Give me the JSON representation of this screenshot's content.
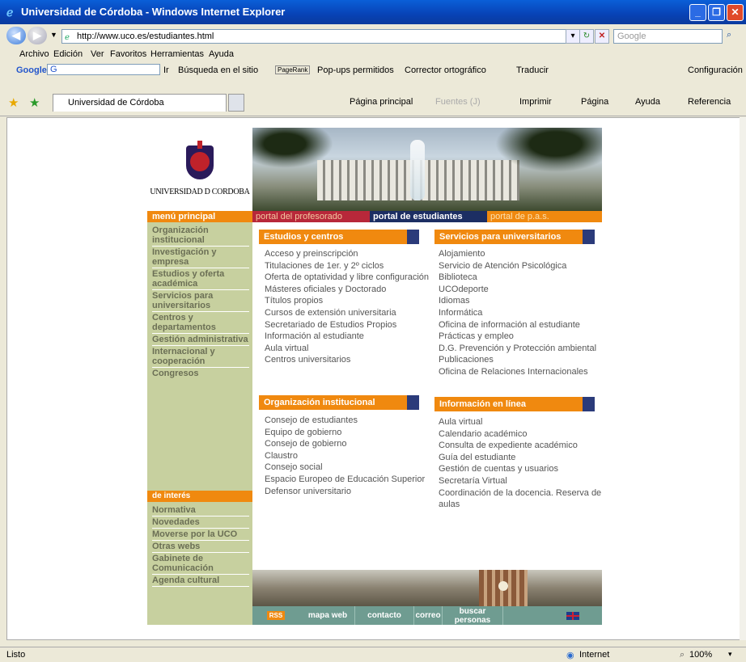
{
  "window": {
    "title": "Universidad de Córdoba - Windows Internet Explorer"
  },
  "address": {
    "url": "http://www.uco.es/estudiantes.html",
    "search_placeholder": "Google"
  },
  "menubar": [
    "Archivo",
    "Edición",
    "Ver",
    "Favoritos",
    "Herramientas",
    "Ayuda"
  ],
  "googlebar": {
    "logo": "Google",
    "g_field": "G",
    "ir": "Ir",
    "busqueda": "Búsqueda en el sitio",
    "pagerank": "PageRank",
    "popups": "Pop-ups permitidos",
    "corrector": "Corrector ortográfico",
    "traducir": "Traducir",
    "config": "Configuración"
  },
  "tabbar": {
    "tab_title": "Universidad de Córdoba",
    "pagina_principal": "Página principal",
    "fuentes": "Fuentes (J)",
    "imprimir": "Imprimir",
    "pagina": "Página",
    "ayuda": "Ayuda",
    "referencia": "Referencia"
  },
  "status": {
    "text": "Listo",
    "zone": "Internet",
    "zoom": "100%"
  },
  "site": {
    "logo_text": "UNIVERSIDAD D CORDOBA",
    "menu_head": "menú principal",
    "menu": [
      "Organización institucional",
      "Investigación y empresa",
      "Estudios y oferta académica",
      "Servicios para universitarios",
      "Centros y departamentos",
      "Gestión administrativa",
      "Internacional y cooperación",
      "Congresos"
    ],
    "interest_head": "de interés",
    "interest": [
      "Normativa",
      "Novedades",
      "Moverse por la UCO",
      "Otras webs",
      "Gabinete de Comunicación",
      "Agenda cultural"
    ],
    "portals": {
      "profesorado": "portal del profesorado",
      "estudiantes": "portal de estudiantes",
      "pas": "portal de p.a.s."
    },
    "estudios": {
      "title": "Estudios y centros",
      "links": [
        "Acceso y preinscripción",
        "Titulaciones de 1er. y 2º ciclos",
        "Oferta de optatividad y libre configuración",
        "Másteres oficiales y Doctorado",
        "Títulos propios",
        "Cursos de extensión universitaria",
        "Secretariado de Estudios Propios",
        "Información al estudiante",
        "Aula virtual",
        "Centros universitarios"
      ]
    },
    "servicios": {
      "title": "Servicios para universitarios",
      "links": [
        "Alojamiento",
        "Servicio de Atención Psicológica",
        "Biblioteca",
        "UCOdeporte",
        "Idiomas",
        "Informática",
        "Oficina de información al estudiante",
        "Prácticas y empleo",
        "D.G. Prevención y Protección ambiental",
        "Publicaciones",
        "Oficina de Relaciones Internacionales"
      ]
    },
    "organizacion": {
      "title": "Organización institucional",
      "links": [
        "Consejo de estudiantes",
        "Equipo de gobierno",
        "Consejo de gobierno",
        "Claustro",
        "Consejo social",
        "Espacio Europeo de Educación Superior",
        "Defensor universitario"
      ]
    },
    "informacion": {
      "title": "Información en línea",
      "links": [
        "Aula virtual",
        "Calendario académico",
        "Consulta de expediente académico",
        "Guía del estudiante",
        "Gestión de cuentas y usuarios",
        "Secretaría Virtual",
        "Coordinación de la docencia. Reserva de",
        "aulas"
      ]
    },
    "footer": {
      "rss": "RSS",
      "mapa": "mapa web",
      "contacto": "contacto",
      "correo": "correo",
      "buscar": "buscar",
      "personas": "personas"
    }
  }
}
